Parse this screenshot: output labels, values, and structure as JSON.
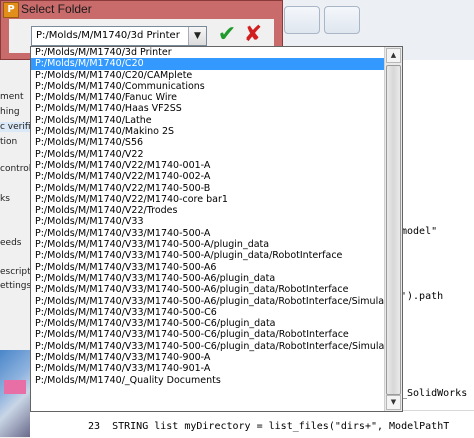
{
  "dialog": {
    "title": "Select Folder",
    "app_icon": "P",
    "combo_value": "P:/Molds/M/M1740/3d Printer",
    "ok_icon": "checkmark-icon",
    "cancel_icon": "close-icon",
    "ok_glyph": "✔",
    "cancel_glyph": "✘",
    "dropdown_arrow": "▼"
  },
  "dropdown": {
    "selected_index": 1,
    "items": [
      "P:/Molds/M/M1740/3d Printer",
      "P:/Molds/M/M1740/C20",
      "P:/Molds/M/M1740/C20/CAMplete",
      "P:/Molds/M/M1740/Communications",
      "P:/Molds/M/M1740/Fanuc Wire",
      "P:/Molds/M/M1740/Haas VF2SS",
      "P:/Molds/M/M1740/Lathe",
      "P:/Molds/M/M1740/Makino 2S",
      "P:/Molds/M/M1740/S56",
      "P:/Molds/M/M1740/V22",
      "P:/Molds/M/M1740/V22/M1740-001-A",
      "P:/Molds/M/M1740/V22/M1740-002-A",
      "P:/Molds/M/M1740/V22/M1740-500-B",
      "P:/Molds/M/M1740/V22/M1740-core bar1",
      "P:/Molds/M/M1740/V22/Trodes",
      "P:/Molds/M/M1740/V33",
      "P:/Molds/M/M1740/V33/M1740-500-A",
      "P:/Molds/M/M1740/V33/M1740-500-A/plugin_data",
      "P:/Molds/M/M1740/V33/M1740-500-A/plugin_data/RobotInterface",
      "P:/Molds/M/M1740/V33/M1740-500-A6",
      "P:/Molds/M/M1740/V33/M1740-500-A6/plugin_data",
      "P:/Molds/M/M1740/V33/M1740-500-A6/plugin_data/RobotInterface",
      "P:/Molds/M/M1740/V33/M1740-500-A6/plugin_data/RobotInterface/Simulation Fil",
      "P:/Molds/M/M1740/V33/M1740-500-C6",
      "P:/Molds/M/M1740/V33/M1740-500-C6/plugin_data",
      "P:/Molds/M/M1740/V33/M1740-500-C6/plugin_data/RobotInterface",
      "P:/Molds/M/M1740/V33/M1740-500-C6/plugin_data/RobotInterface/Simulation Fil",
      "P:/Molds/M/M1740/V33/M1740-900-A",
      "P:/Molds/M/M1740/V33/M1740-901-A",
      "P:/Molds/M/M1740/_Quality Documents"
    ]
  },
  "background": {
    "left_labels": [
      "ment",
      "hing",
      "c verifi",
      "tion",
      "control",
      "ks",
      "eeds",
      "escripti",
      "ettings"
    ],
    "code_fragments": [
      "model\"",
      "').path",
      "_SolidWorks",
      "ModelPathT"
    ],
    "code_line_number": "23",
    "code_line_text": "STRING list myDirectory = list_files(\"dirs+\", ModelPathT"
  }
}
